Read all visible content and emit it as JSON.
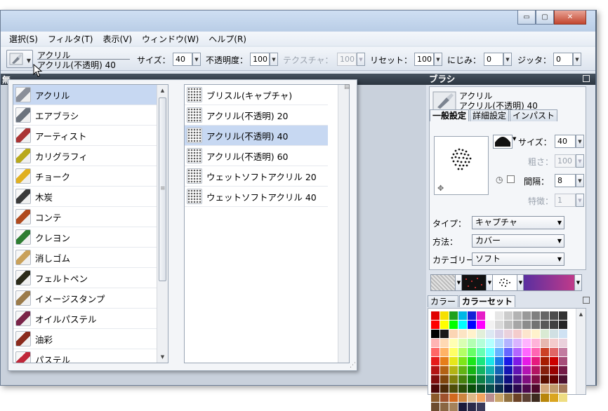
{
  "menu": [
    "選択(S)",
    "フィルタ(T)",
    "表示(V)",
    "ウィンドウ(W)",
    "ヘルプ(R)"
  ],
  "window_controls": {
    "minimize": "▭",
    "maximize": "▢",
    "close": "✕"
  },
  "toolbar": {
    "brush_category": "アクリル",
    "brush_variant": "アクリル(不透明) 40",
    "size_label": "サイズ：",
    "size_value": "40",
    "opacity_label": "不透明度：",
    "opacity_value": "100",
    "texture_label": "テクスチャ：",
    "texture_value": "100",
    "reset_label": "リセット：",
    "reset_value": "100",
    "bleed_label": "にじみ：",
    "bleed_value": "0",
    "jitter_label": "ジッタ：",
    "jitter_value": "0"
  },
  "canvas_tab_label": "無",
  "categories": [
    {
      "label": "アクリル",
      "icon": "acrylic-brush-icon",
      "color": "#8a8f99",
      "selected": true
    },
    {
      "label": "エアブラシ",
      "icon": "airbrush-icon",
      "color": "#6c737d"
    },
    {
      "label": "アーティスト",
      "icon": "artist-brush-icon",
      "color": "#a33"
    },
    {
      "label": "カリグラフィ",
      "icon": "calligraphy-icon",
      "color": "#b8a81a"
    },
    {
      "label": "チョーク",
      "icon": "chalk-icon",
      "color": "#e0b020"
    },
    {
      "label": "木炭",
      "icon": "charcoal-icon",
      "color": "#3a3a3a"
    },
    {
      "label": "コンテ",
      "icon": "conte-icon",
      "color": "#b04a1e"
    },
    {
      "label": "クレヨン",
      "icon": "crayon-icon",
      "color": "#2e7d32"
    },
    {
      "label": "消しゴム",
      "icon": "eraser-icon",
      "color": "#c9a15a"
    },
    {
      "label": "フェルトペン",
      "icon": "felt-pen-icon",
      "color": "#2b2b1a"
    },
    {
      "label": "イメージスタンプ",
      "icon": "image-stamp-icon",
      "color": "#9b7b4a"
    },
    {
      "label": "オイルパステル",
      "icon": "oil-pastel-icon",
      "color": "#7a2448"
    },
    {
      "label": "油彩",
      "icon": "oil-paint-icon",
      "color": "#8a2a1c"
    },
    {
      "label": "パステル",
      "icon": "pastel-icon",
      "color": "#c0283a"
    }
  ],
  "variants": [
    {
      "label": "ブリスル(キャプチャ)",
      "icon": "bristle-capture-icon"
    },
    {
      "label": "アクリル(不透明) 20",
      "icon": "acrylic-opaque-20-icon"
    },
    {
      "label": "アクリル(不透明) 40",
      "icon": "acrylic-opaque-40-icon",
      "selected": true
    },
    {
      "label": "アクリル(不透明) 60",
      "icon": "acrylic-opaque-60-icon"
    },
    {
      "label": "ウェットソフトアクリル 20",
      "icon": "wet-soft-acrylic-20-icon"
    },
    {
      "label": "ウェットソフトアクリル 40",
      "icon": "wet-soft-acrylic-40-icon"
    }
  ],
  "brush_panel": {
    "title": "ブラシ",
    "brush_name": "アクリル",
    "brush_variant": "アクリル(不透明) 40",
    "tabs": [
      "一般設定",
      "詳細設定",
      "インパスト"
    ],
    "size_label": "サイズ：",
    "size_value": "40",
    "thickness_label": "粗さ：",
    "thickness_value": "100",
    "spacing_label": "間隔：",
    "spacing_value": "8",
    "feature_label": "特徴：",
    "feature_value": "1",
    "type_label": "タイプ：",
    "type_value": "キャプチャ",
    "method_label": "方法：",
    "method_value": "カバー",
    "category_label": "カテゴリー：",
    "category_value": "ソフト"
  },
  "color_panel": {
    "tabs": [
      "カラー",
      "カラーセット"
    ]
  },
  "palette_rows": [
    [
      "#e00000",
      "#f5e000",
      "#1ea11e",
      "#00b6e6",
      "#1420d6",
      "#e61ec8",
      "#ffffff",
      "#e6e6e6",
      "#cccccc",
      "#b3b3b3",
      "#999999",
      "#808080",
      "#666666",
      "#4d4d4d",
      "#333333"
    ],
    [
      "#ff0000",
      "#ffff00",
      "#00ff00",
      "#00ffff",
      "#0000ff",
      "#ff00ff",
      "#f2f2f2",
      "#d9d9d9",
      "#bfbfbf",
      "#a6a6a6",
      "#8c8c8c",
      "#737373",
      "#595959",
      "#404040",
      "#262626"
    ],
    [
      "#000000",
      "#1a1a1a",
      "#fcd5b4",
      "#fce4c4",
      "#fff2cc",
      "#e2efda",
      "#dde8f3",
      "#d9d2e9",
      "#ead1dc",
      "#f4cccc",
      "#fce5cd",
      "#fff2cc",
      "#d9ead3",
      "#d0e0e3",
      "#cfe2f3"
    ],
    [
      "#ffb3b3",
      "#ffd9b3",
      "#ffffb3",
      "#d9ffb3",
      "#b3ffb3",
      "#b3ffd9",
      "#b3ffff",
      "#b3d9ff",
      "#b3b3ff",
      "#d9b3ff",
      "#ffb3ff",
      "#ffb3d9",
      "#e6b8af",
      "#f4cccc",
      "#ead1dc"
    ],
    [
      "#ff6666",
      "#ffb366",
      "#ffff66",
      "#b3ff66",
      "#66ff66",
      "#66ffb3",
      "#66ffff",
      "#66b3ff",
      "#6666ff",
      "#b366ff",
      "#ff66ff",
      "#ff66b3",
      "#cc4125",
      "#e06666",
      "#c27ba0"
    ],
    [
      "#e61a1a",
      "#e67e1a",
      "#e6e61a",
      "#7ee61a",
      "#1ae61a",
      "#1ae67e",
      "#1ae6e6",
      "#1a7ee6",
      "#1a1ae6",
      "#7e1ae6",
      "#e61ae6",
      "#e61a7e",
      "#a61c00",
      "#cc0000",
      "#a64d79"
    ],
    [
      "#b31414",
      "#b36214",
      "#b3b314",
      "#62b314",
      "#14b314",
      "#14b362",
      "#14b3b3",
      "#1462b3",
      "#1414b3",
      "#6214b3",
      "#b314b3",
      "#b31462",
      "#85200c",
      "#990000",
      "#741b47"
    ],
    [
      "#800e0e",
      "#80460e",
      "#80800e",
      "#46800e",
      "#0e800e",
      "#0e8046",
      "#0e8080",
      "#0e4680",
      "#0e0e80",
      "#460e80",
      "#800e80",
      "#800e46",
      "#5b0f00",
      "#660000",
      "#4c1130"
    ],
    [
      "#4d0808",
      "#4d2a08",
      "#4d4d08",
      "#2a4d08",
      "#084d08",
      "#084d2a",
      "#084d4d",
      "#082a4d",
      "#08084d",
      "#2a084d",
      "#4d084d",
      "#4d082a",
      "#d2a679",
      "#c19a6b",
      "#a67b5b"
    ],
    [
      "#8b5a2b",
      "#a0522d",
      "#d2691e",
      "#cd853f",
      "#deb887",
      "#f4a460",
      "#bc8f8f",
      "#c9a66b",
      "#8f6f3f",
      "#6b4226",
      "#5c4033",
      "#3d2b1f",
      "#b8860b",
      "#daa520",
      "#eedd82"
    ],
    [
      "#6d4c2f",
      "#8a6642",
      "#a5825a",
      "#1a1a3a",
      "#2a2a4a",
      "#3a3a5a"
    ]
  ]
}
